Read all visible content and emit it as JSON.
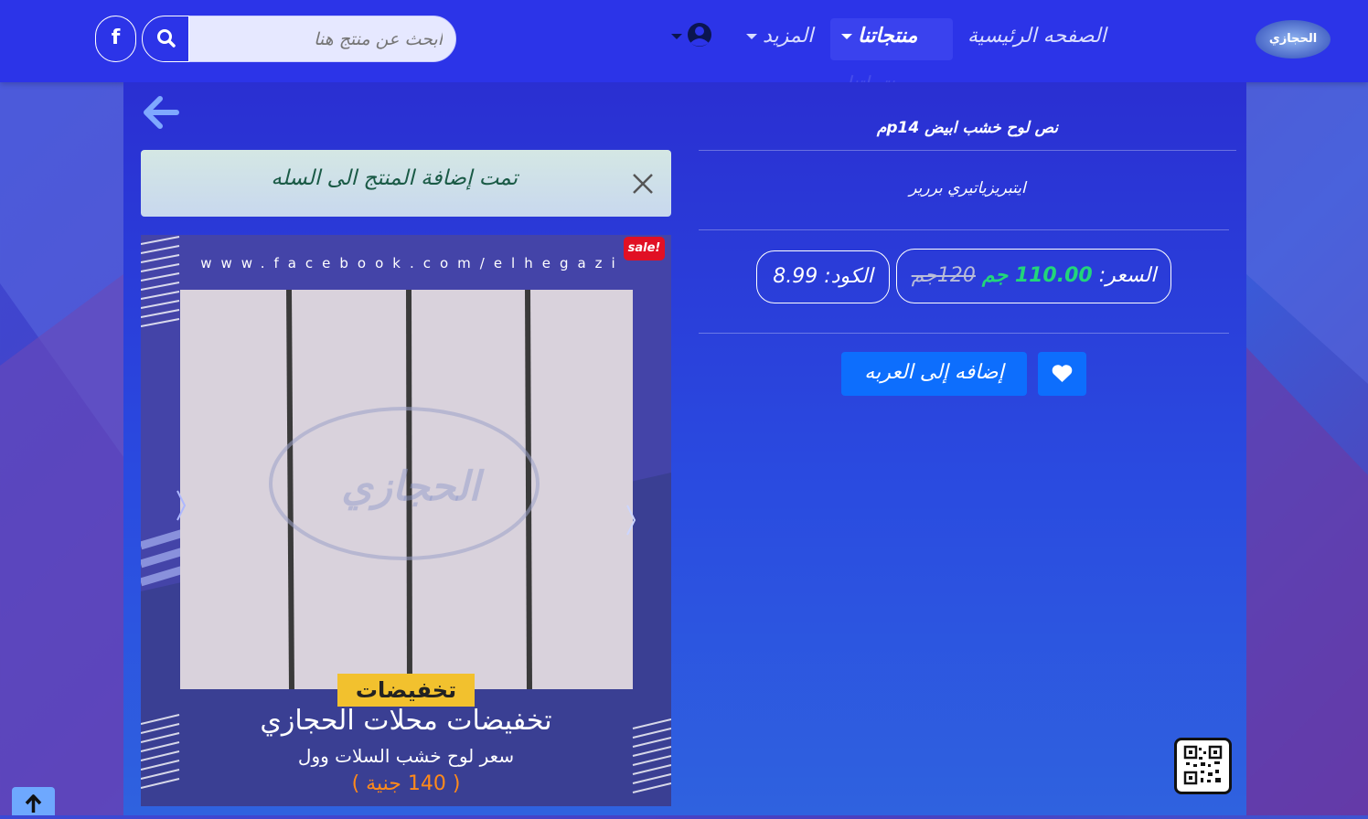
{
  "nav": {
    "logo_text": "الحجازي",
    "home": "الصفحه الرئيسية",
    "products": "منتجاتنا",
    "more": "المزيد",
    "search_placeholder": "ابحث عن منتج هنا",
    "facebook_icon": "f",
    "dropdown_ghost": "منتجاتنا"
  },
  "alert": {
    "message": "تمت إضافة المنتج الى السله"
  },
  "product": {
    "title": "نص لوح خشب ابيض p14م",
    "description": "ايتبريزياتيري بررير",
    "price_label": "السعر:",
    "price_new": "110.00 جم",
    "price_old": "120جم",
    "code_label": "الكود:",
    "code_value": "8.99",
    "sale_badge": "sale!",
    "add_to_cart": "إضافه إلى العربه"
  },
  "image": {
    "url_text": "www.facebook.com/elhegazi",
    "tag": "تخفيضات",
    "headline": "تخفيضات محلات الحجازي",
    "subline": "سعر لوح خشب السلات وول",
    "price_note": "( 140 جنية )",
    "watermark": "الحجازي"
  },
  "colors": {
    "navbar": "#2c34e8",
    "accent_btn": "#0d6efd",
    "price_green": "#22d67a",
    "sale_red": "#e11024"
  },
  "icons": [
    "search-icon",
    "facebook-icon",
    "user-circle-icon",
    "back-arrow-icon",
    "close-icon",
    "heart-icon",
    "arrow-up-icon",
    "qr-code-icon"
  ]
}
